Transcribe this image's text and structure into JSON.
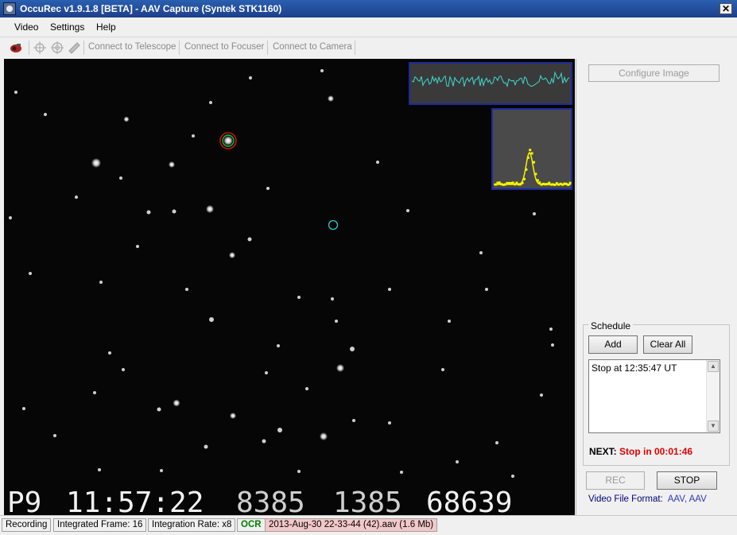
{
  "window": {
    "title": "OccuRec v1.9.1.8 [BETA] - AAV Capture (Syntek STK1160)",
    "close_glyph": "✕"
  },
  "menu": [
    {
      "label": "Video"
    },
    {
      "label": "Settings"
    },
    {
      "label": "Help"
    }
  ],
  "toolbar": {
    "connect_telescope": "Connect to Telescope",
    "connect_focuser": "Connect to Focuser",
    "connect_camera": "Connect to Camera"
  },
  "video": {
    "osd": {
      "field": "P9",
      "time": "11:57:22",
      "num1": "8385",
      "num2": "1385",
      "num3": "68639"
    }
  },
  "panel": {
    "configure_image": "Configure Image",
    "schedule": {
      "title": "Schedule",
      "add": "Add",
      "clear_all": "Clear All",
      "items": [
        "Stop at 12:35:47 UT"
      ],
      "next_label": "NEXT:",
      "next_value": "Stop in 00:01:46"
    },
    "rec": "REC",
    "stop": "STOP",
    "video_file_format_label": "Video File Format:",
    "video_file_format_value": "AAV, AAV"
  },
  "status": {
    "recording": "Recording",
    "integrated_frame": "Integrated Frame: 16",
    "integration_rate": "Integration Rate: x8",
    "ocr": "OCR",
    "file": "2013-Aug-30 22-33-44 (42).aav (1.6 Mb)"
  },
  "colors": {
    "accent": "#1c3f8a",
    "ocr_green": "#008000",
    "next_red": "#e00000",
    "trace": "#3fd9d0",
    "profile": "#f4f400"
  }
}
